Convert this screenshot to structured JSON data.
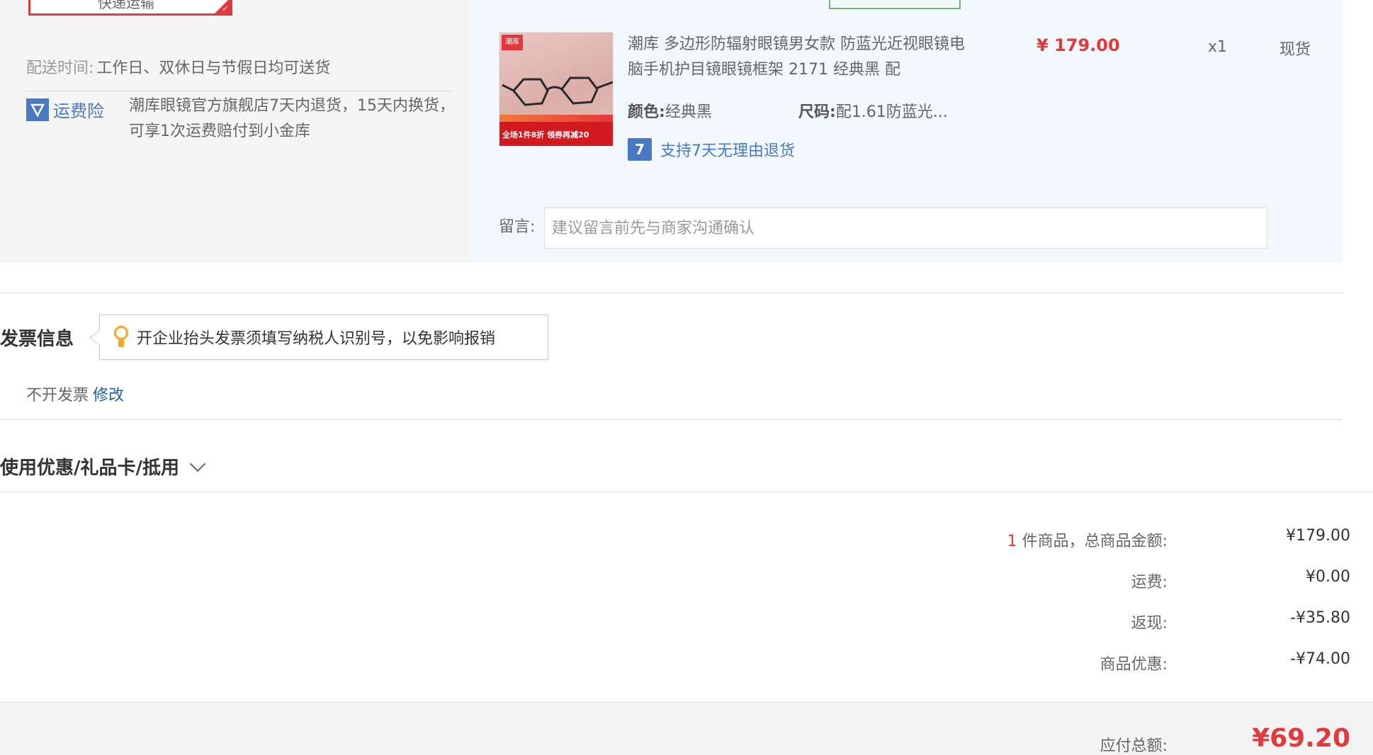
{
  "delivery": {
    "shipping_method": "快递运输",
    "time_label": "配送时间:",
    "time_value": "工作日、双休日与节假日均可送货",
    "insurance_label": "运费险",
    "insurance_desc": "潮库眼镜官方旗舰店7天内退货，15天内换货，可享1次运费赔付到小金库"
  },
  "product": {
    "thumb_logo": "潮库",
    "thumb_banner": "全场1件8折 领券再减20",
    "title": "潮库 多边形防辐射眼镜男女款 防蓝光近视眼镜电脑手机护目镜眼镜框架 2171 经典黑 配",
    "price": "¥ 179.00",
    "quantity": "x1",
    "stock": "现货",
    "color_label": "颜色:",
    "color_value": "经典黑",
    "size_label": "尺码:",
    "size_value": "配1.61防蓝光...",
    "return_icon": "7",
    "return_policy": "支持7天无理由退货",
    "message_label": "留言:",
    "message_placeholder": "建议留言前先与商家沟通确认"
  },
  "invoice": {
    "title": "发票信息",
    "tip": "开企业抬头发票须填写纳税人识别号，以免影响报销",
    "status": "不开发票",
    "edit_link": "修改"
  },
  "coupon": {
    "title": "使用优惠/礼品卡/抵用"
  },
  "summary": {
    "item_count": "1",
    "items_label": " 件商品，总商品金额:",
    "items_total": "¥179.00",
    "shipping_label": "运费:",
    "shipping_value": "¥0.00",
    "cashback_label": "返现:",
    "cashback_value": "-¥35.80",
    "discount_label": "商品优惠:",
    "discount_value": "-¥74.00",
    "payable_label": "应付总额:",
    "payable_value": "¥69.20"
  },
  "colors": {
    "accent_red": "#e4393c",
    "link_blue": "#4a78c2",
    "panel_blue": "#f1f9fd",
    "panel_gray": "#f5f5f5"
  },
  "icons": [
    "shield-icon",
    "return-7day-icon",
    "lightbulb-icon",
    "chevron-down-icon"
  ]
}
